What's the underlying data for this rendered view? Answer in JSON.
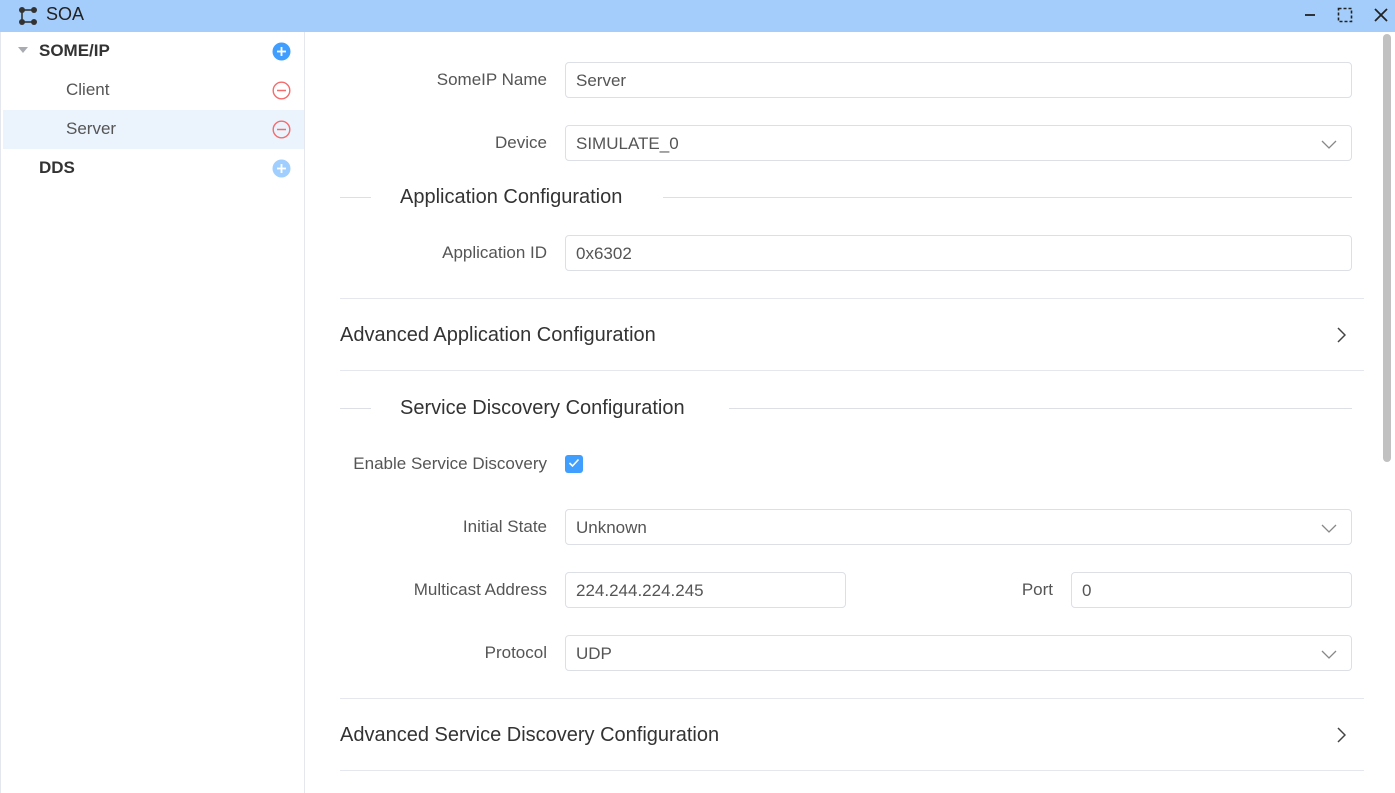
{
  "window": {
    "title": "SOA",
    "icons": {
      "app": "graph-nodes-icon",
      "minimize": "minimize-icon",
      "maximize": "maximize-icon",
      "close": "close-icon"
    }
  },
  "sidebar": {
    "nodes": [
      {
        "label": "SOME/IP",
        "action_icon": "add-circle-icon",
        "expanded": true
      },
      {
        "label": "Client",
        "action_icon": "remove-circle-icon"
      },
      {
        "label": "Server",
        "action_icon": "remove-circle-icon",
        "selected": true
      },
      {
        "label": "DDS",
        "action_icon": "add-circle-icon"
      }
    ]
  },
  "form": {
    "someip_name": {
      "label": "SomeIP Name",
      "value": "Server"
    },
    "device": {
      "label": "Device",
      "value": "SIMULATE_0"
    },
    "app_config": {
      "title": "Application Configuration",
      "application_id": {
        "label": "Application ID",
        "value": "0x6302"
      }
    },
    "advanced_app_config": {
      "title": "Advanced Application Configuration"
    },
    "sd_config": {
      "title": "Service Discovery Configuration",
      "enable_sd": {
        "label": "Enable Service Discovery",
        "checked": true
      },
      "initial_state": {
        "label": "Initial State",
        "value": "Unknown"
      },
      "multicast_address": {
        "label": "Multicast Address",
        "value": "224.244.224.245"
      },
      "port": {
        "label": "Port",
        "value": "0"
      },
      "protocol": {
        "label": "Protocol",
        "value": "UDP"
      }
    },
    "advanced_sd_config": {
      "title": "Advanced Service Discovery Configuration"
    }
  },
  "colors": {
    "titlebar_bg": "#a4cdfb",
    "accent": "#409eff",
    "danger": "#f56c6c",
    "selected_bg": "#ebf3fd"
  }
}
